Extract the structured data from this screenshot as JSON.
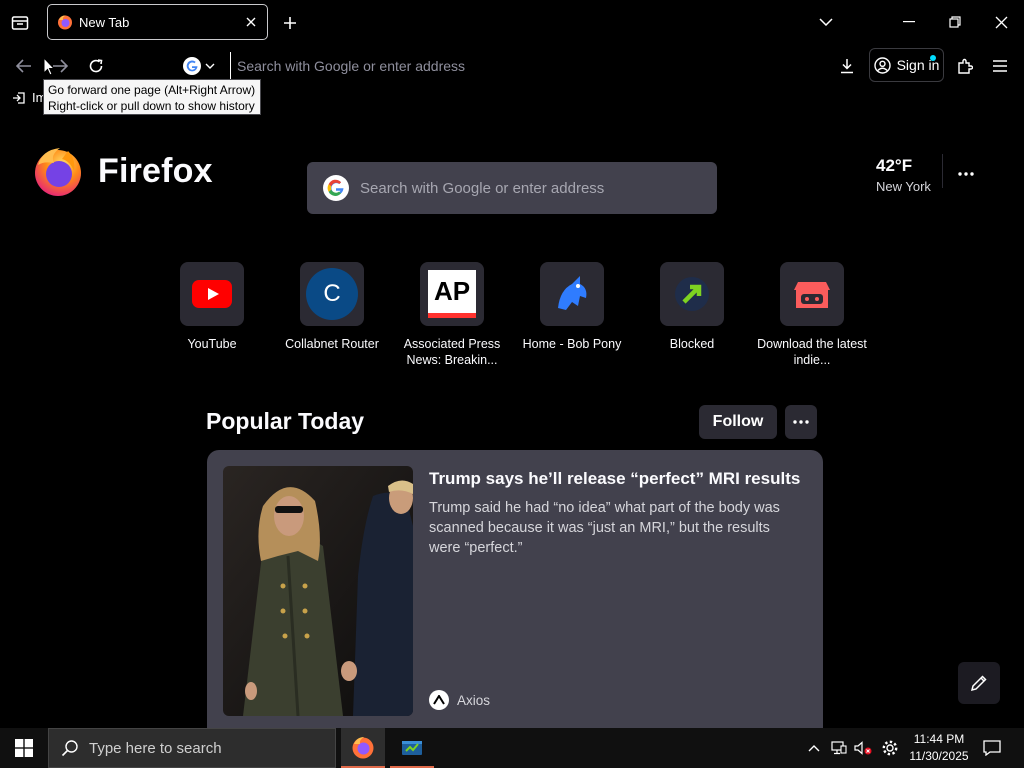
{
  "window": {
    "tab_title": "New Tab"
  },
  "navbar": {
    "url_placeholder": "Search with Google or enter address",
    "signin_label": "Sign in"
  },
  "bookmarks": {
    "import_label": "Im"
  },
  "tooltip": {
    "line1": "Go forward one page (Alt+Right Arrow)",
    "line2": "Right-click or pull down to show history"
  },
  "brand": {
    "name": "Firefox"
  },
  "search": {
    "placeholder": "Search with Google or enter address"
  },
  "weather": {
    "temp": "42°F",
    "location": "New York"
  },
  "shortcuts": [
    {
      "label": "YouTube",
      "icon": "youtube-icon"
    },
    {
      "label": "Collabnet Router",
      "icon": "letter-c-icon",
      "letter": "C"
    },
    {
      "label": "Associated Press News: Breakin...",
      "icon": "ap-logo-icon",
      "letter": "AP"
    },
    {
      "label": "Home - Bob Pony",
      "icon": "bob-pony-icon"
    },
    {
      "label": "Blocked",
      "icon": "blocked-arrow-icon"
    },
    {
      "label": "Download the latest indie...",
      "icon": "itch-io-icon"
    }
  ],
  "popular": {
    "title": "Popular Today",
    "follow_label": "Follow"
  },
  "story": {
    "headline": "Trump says he’ll release “perfect” MRI results",
    "excerpt": "Trump said he had “no idea” what part of the body was scanned because it was “just an MRI,” but the results were “perfect.”",
    "source": "Axios"
  },
  "taskbar": {
    "search_placeholder": "Type here to search",
    "time": "11:44 PM",
    "date": "11/30/2025"
  },
  "colors": {
    "page_bg": "#000000",
    "card_bg": "#42414d",
    "tile_bg": "#2b2a33",
    "accent_blue": "#00ddff"
  }
}
